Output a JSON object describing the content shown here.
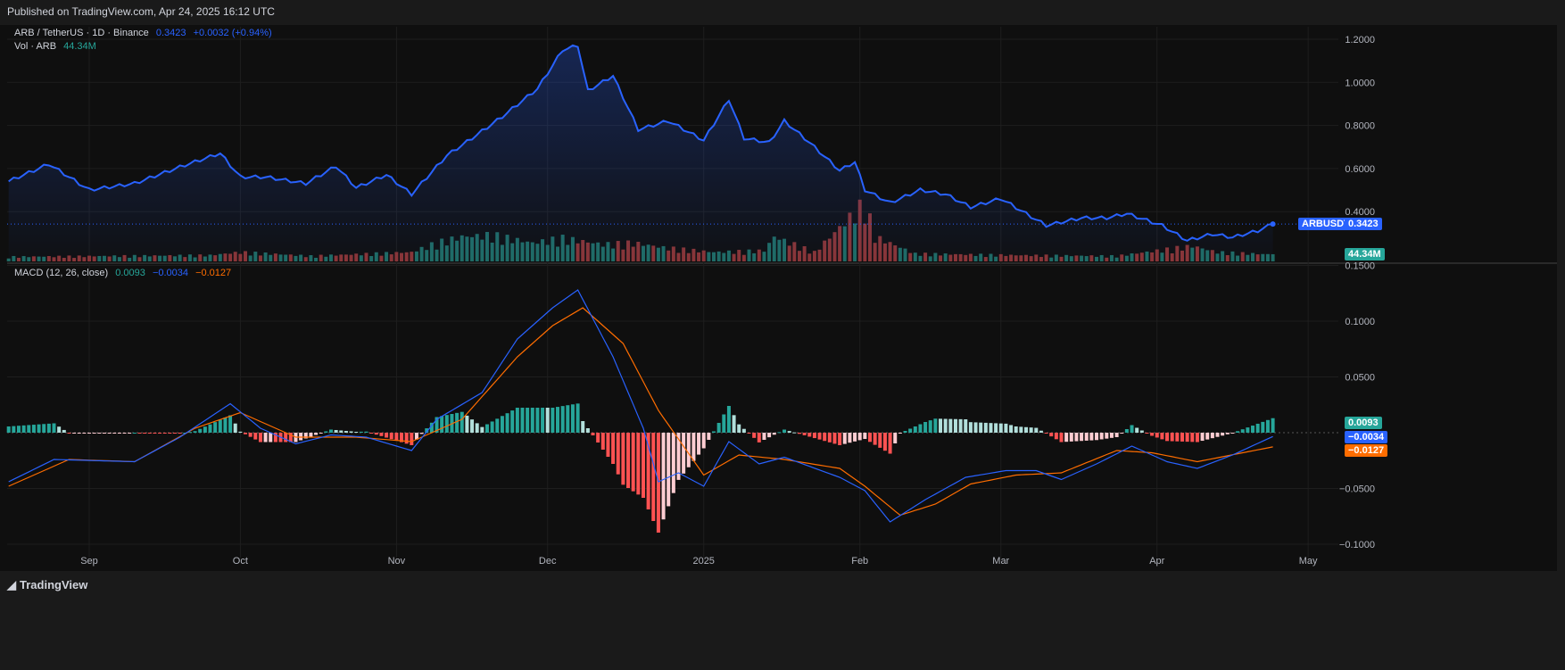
{
  "header": {
    "published": "Published on TradingView.com, Apr 24, 2025 16:12 UTC"
  },
  "legend": {
    "symbol": "ARB / TetherUS · 1D · Binance",
    "price": "0.3423",
    "change": "+0.0032 (+0.94%)",
    "vol_label": "Vol · ARB",
    "vol_value": "44.34M",
    "macd_label": "MACD (12, 26, close)",
    "macd_hist": "0.0093",
    "macd_line": "−0.0034",
    "macd_signal": "−0.0127"
  },
  "footer": {
    "brand": "TradingView"
  },
  "colors": {
    "price": "#2962ff",
    "up": "#26a69a",
    "down": "#ef5350",
    "macd": "#2962ff",
    "signal": "#ff6d00",
    "hist_up": "#26a69a",
    "hist_up_fade": "#b2dfdb",
    "hist_dn": "#ff5252",
    "hist_dn_fade": "#ffcdd2"
  },
  "chart_data": {
    "type": "line",
    "x_unit": "days since 2024-08-16",
    "time_ticks": [
      {
        "label": "Sep",
        "day": 16
      },
      {
        "label": "Oct",
        "day": 46
      },
      {
        "label": "Nov",
        "day": 77
      },
      {
        "label": "Dec",
        "day": 107
      },
      {
        "label": "2025",
        "day": 138
      },
      {
        "label": "Feb",
        "day": 169
      },
      {
        "label": "Mar",
        "day": 197
      },
      {
        "label": "Apr",
        "day": 228
      },
      {
        "label": "May",
        "day": 258
      }
    ],
    "price_axis": {
      "ylim": [
        0.148,
        1.26
      ],
      "ticks": [
        "1.2000",
        "1.0000",
        "0.8000",
        "0.6000",
        "0.4000"
      ],
      "last_label": "ARBUSDT",
      "last_value": "0.3423",
      "volume_label": "44.34M"
    },
    "macd_axis": {
      "ylim": [
        -0.1,
        0.15
      ],
      "ticks": [
        "0.1500",
        "0.1000",
        "0.0500",
        "−0.0500",
        "−0.1000"
      ],
      "labels": {
        "hist": "0.0093",
        "macd": "−0.0034",
        "signal": "−0.0127"
      }
    },
    "price": [
      [
        0,
        0.54
      ],
      [
        8,
        0.62
      ],
      [
        16,
        0.5
      ],
      [
        25,
        0.53
      ],
      [
        35,
        0.615
      ],
      [
        42,
        0.67
      ],
      [
        46,
        0.56
      ],
      [
        51,
        0.56
      ],
      [
        59,
        0.53
      ],
      [
        65,
        0.61
      ],
      [
        69,
        0.51
      ],
      [
        75,
        0.57
      ],
      [
        80,
        0.48
      ],
      [
        87,
        0.66
      ],
      [
        92,
        0.74
      ],
      [
        98,
        0.84
      ],
      [
        105,
        0.97
      ],
      [
        110,
        1.15
      ],
      [
        113,
        1.17
      ],
      [
        115,
        0.96
      ],
      [
        120,
        1.03
      ],
      [
        125,
        0.78
      ],
      [
        131,
        0.82
      ],
      [
        138,
        0.73
      ],
      [
        143,
        0.92
      ],
      [
        146,
        0.74
      ],
      [
        151,
        0.72
      ],
      [
        154,
        0.82
      ],
      [
        159,
        0.72
      ],
      [
        165,
        0.59
      ],
      [
        168,
        0.63
      ],
      [
        170,
        0.5
      ],
      [
        175,
        0.44
      ],
      [
        181,
        0.5
      ],
      [
        186,
        0.48
      ],
      [
        191,
        0.42
      ],
      [
        197,
        0.46
      ],
      [
        202,
        0.39
      ],
      [
        206,
        0.335
      ],
      [
        213,
        0.37
      ],
      [
        218,
        0.37
      ],
      [
        222,
        0.39
      ],
      [
        229,
        0.335
      ],
      [
        234,
        0.265
      ],
      [
        239,
        0.295
      ],
      [
        243,
        0.28
      ],
      [
        248,
        0.31
      ],
      [
        251,
        0.3423
      ]
    ],
    "volume_M": [
      [
        0,
        30
      ],
      [
        20,
        35
      ],
      [
        40,
        40
      ],
      [
        46,
        60
      ],
      [
        60,
        35
      ],
      [
        80,
        60
      ],
      [
        85,
        120
      ],
      [
        90,
        160
      ],
      [
        96,
        170
      ],
      [
        104,
        120
      ],
      [
        110,
        150
      ],
      [
        118,
        110
      ],
      [
        124,
        120
      ],
      [
        130,
        90
      ],
      [
        140,
        60
      ],
      [
        150,
        70
      ],
      [
        152,
        160
      ],
      [
        160,
        60
      ],
      [
        170,
        380
      ],
      [
        172,
        160
      ],
      [
        180,
        50
      ],
      [
        200,
        40
      ],
      [
        220,
        35
      ],
      [
        235,
        100
      ],
      [
        240,
        60
      ],
      [
        251,
        44.34
      ]
    ],
    "macd": [
      [
        0,
        -0.044
      ],
      [
        9,
        -0.024
      ],
      [
        25,
        -0.026
      ],
      [
        34,
        -0.004
      ],
      [
        44,
        0.026
      ],
      [
        50,
        0.004
      ],
      [
        57,
        -0.01
      ],
      [
        64,
        -0.002
      ],
      [
        71,
        -0.004
      ],
      [
        80,
        -0.016
      ],
      [
        85,
        0.012
      ],
      [
        94,
        0.036
      ],
      [
        101,
        0.084
      ],
      [
        108,
        0.112
      ],
      [
        113,
        0.128
      ],
      [
        120,
        0.068
      ],
      [
        126,
        0.004
      ],
      [
        129,
        -0.044
      ],
      [
        133,
        -0.036
      ],
      [
        138,
        -0.048
      ],
      [
        143,
        -0.008
      ],
      [
        149,
        -0.028
      ],
      [
        154,
        -0.022
      ],
      [
        165,
        -0.04
      ],
      [
        170,
        -0.052
      ],
      [
        175,
        -0.08
      ],
      [
        182,
        -0.06
      ],
      [
        190,
        -0.04
      ],
      [
        198,
        -0.034
      ],
      [
        204,
        -0.034
      ],
      [
        209,
        -0.042
      ],
      [
        216,
        -0.028
      ],
      [
        223,
        -0.012
      ],
      [
        230,
        -0.026
      ],
      [
        236,
        -0.032
      ],
      [
        243,
        -0.02
      ],
      [
        251,
        -0.0034
      ]
    ],
    "signal": [
      [
        0,
        -0.048
      ],
      [
        12,
        -0.024
      ],
      [
        25,
        -0.026
      ],
      [
        37,
        0.004
      ],
      [
        46,
        0.018
      ],
      [
        57,
        -0.004
      ],
      [
        69,
        -0.004
      ],
      [
        80,
        -0.008
      ],
      [
        90,
        0.012
      ],
      [
        101,
        0.068
      ],
      [
        108,
        0.096
      ],
      [
        114,
        0.112
      ],
      [
        122,
        0.08
      ],
      [
        129,
        0.02
      ],
      [
        138,
        -0.038
      ],
      [
        145,
        -0.02
      ],
      [
        154,
        -0.024
      ],
      [
        165,
        -0.032
      ],
      [
        170,
        -0.048
      ],
      [
        177,
        -0.074
      ],
      [
        184,
        -0.064
      ],
      [
        191,
        -0.046
      ],
      [
        200,
        -0.038
      ],
      [
        209,
        -0.036
      ],
      [
        220,
        -0.016
      ],
      [
        227,
        -0.018
      ],
      [
        236,
        -0.026
      ],
      [
        251,
        -0.0127
      ]
    ]
  }
}
